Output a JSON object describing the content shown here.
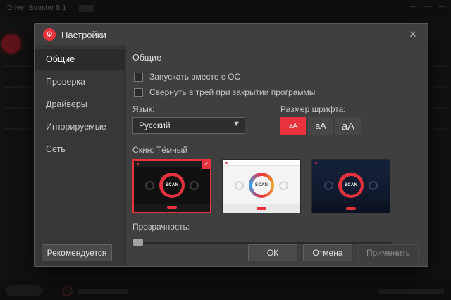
{
  "background": {
    "app_title": "Driver Booster 5.1"
  },
  "icons": {
    "gear": "⚙",
    "close": "✕",
    "check": "✓",
    "dropdown_arrow": "▼"
  },
  "dialog": {
    "title": "Настройки",
    "sidebar": [
      {
        "label": "Общие"
      },
      {
        "label": "Проверка"
      },
      {
        "label": "Драйверы"
      },
      {
        "label": "Игнорируемые"
      },
      {
        "label": "Сеть"
      }
    ],
    "section": {
      "title": "Общие"
    },
    "options": [
      {
        "label": "Запускать вместе с ОС",
        "checked": false
      },
      {
        "label": "Свернуть в трей при закрытии программы",
        "checked": false
      }
    ],
    "language": {
      "label": "Язык:",
      "value": "Русский"
    },
    "font_size": {
      "label": "Размер шрифта:",
      "options": [
        {
          "label": "аА"
        },
        {
          "label": "аА"
        },
        {
          "label": "аА"
        }
      ],
      "selected_index": 0
    },
    "skin": {
      "label": "Скин: Тёмный",
      "scan_label": "SCAN",
      "selected_index": 0,
      "variants": [
        "dark",
        "white",
        "navy"
      ]
    },
    "transparency": {
      "label": "Прозрачность:",
      "value_percent": 0
    },
    "footer": {
      "recommended": "Рекомендуется",
      "ok": "ОК",
      "cancel": "Отмена",
      "apply": "Применить"
    }
  },
  "colors": {
    "accent_red": "#e8333f",
    "dialog_bg": "#3f3f3f"
  }
}
